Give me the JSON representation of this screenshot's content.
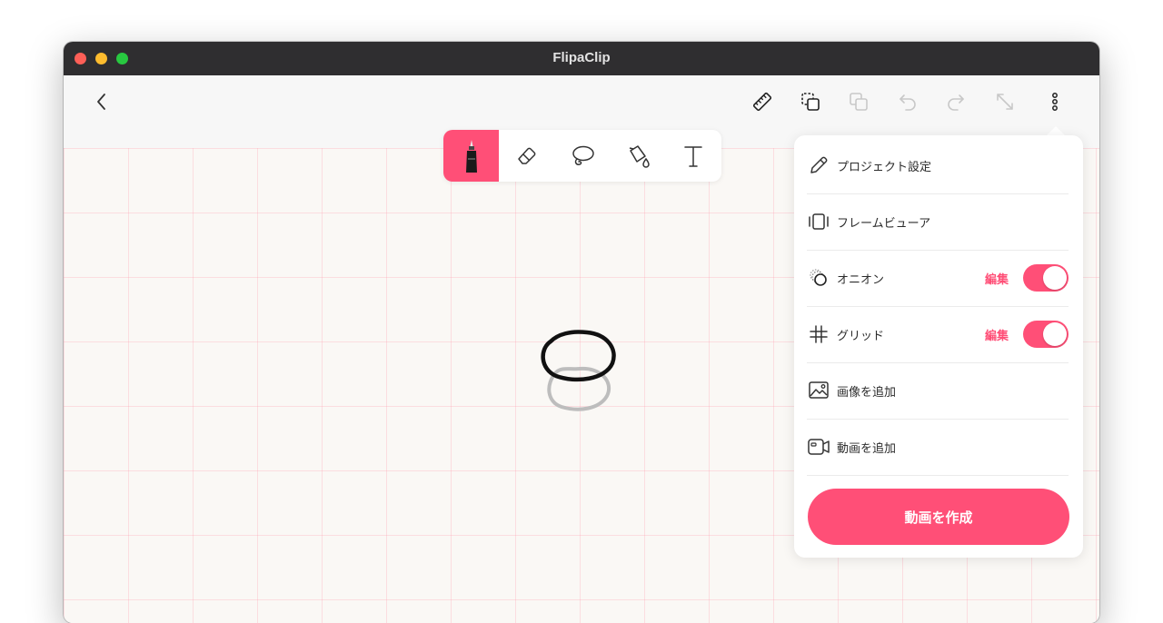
{
  "window": {
    "title": "FlipaClip"
  },
  "toolbar": {
    "icons": [
      "back-icon",
      "ruler-icon",
      "select-duplicate-icon",
      "copy-icon",
      "undo-icon",
      "redo-icon",
      "transform-icon",
      "more-icon"
    ]
  },
  "tools": {
    "items": [
      "pen-icon",
      "eraser-icon",
      "lasso-icon",
      "fill-bucket-icon",
      "text-icon"
    ],
    "active": "pen-icon"
  },
  "menu": {
    "items": [
      {
        "icon": "pencil-icon",
        "label": "プロジェクト設定"
      },
      {
        "icon": "frame-viewer-icon",
        "label": "フレームビューア"
      },
      {
        "icon": "onion-icon",
        "label": "オニオン",
        "edit": "編集",
        "toggle": true
      },
      {
        "icon": "grid-icon",
        "label": "グリッド",
        "edit": "編集",
        "toggle": true
      },
      {
        "icon": "image-icon",
        "label": "画像を追加"
      },
      {
        "icon": "video-icon",
        "label": "動画を追加"
      }
    ],
    "create_button": "動画を作成"
  },
  "colors": {
    "accent": "#ff4f77",
    "titlebar": "#2f2e30",
    "canvas_bg": "#faf8f5",
    "grid_line": "#ffc7d3"
  }
}
